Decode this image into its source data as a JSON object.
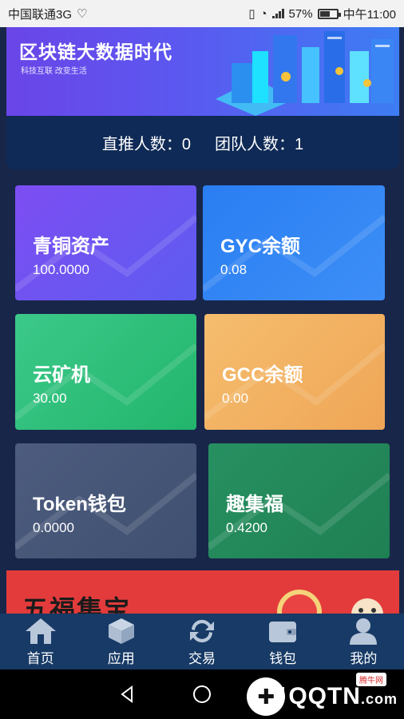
{
  "status_bar": {
    "carrier": "中国联通3G",
    "network": "3G",
    "battery": "57%",
    "time": "中午11:00"
  },
  "banner": {
    "title": "区块链大数据时代",
    "subtitle": "科技互联 改变生活"
  },
  "stats": {
    "direct_label": "直推人数：",
    "direct_value": "0",
    "team_label": "团队人数：",
    "team_value": "1"
  },
  "cards": [
    {
      "title": "青铜资产",
      "value": "100.0000",
      "color": "#6b4ff0"
    },
    {
      "title": "GYC余额",
      "value": "0.08",
      "color": "#2f7ef0"
    },
    {
      "title": "云矿机",
      "value": "30.00",
      "color": "#2fc07a"
    },
    {
      "title": "GCC余额",
      "value": "0.00",
      "color": "#f1b15f"
    },
    {
      "title": "Token钱包",
      "value": "0.0000",
      "color": "#465675"
    },
    {
      "title": "趣集福",
      "value": "0.4200",
      "color": "#23885a"
    }
  ],
  "promo": {
    "text": "五福集宝"
  },
  "tabbar": {
    "items": [
      {
        "label": "首页",
        "icon": "home-icon"
      },
      {
        "label": "应用",
        "icon": "box-icon"
      },
      {
        "label": "交易",
        "icon": "refresh-icon"
      },
      {
        "label": "钱包",
        "icon": "wallet-icon"
      },
      {
        "label": "我的",
        "icon": "user-icon"
      }
    ]
  },
  "watermark": {
    "brand": "QQTN",
    "domain": ".com",
    "badge": "腾牛网"
  },
  "colors": {
    "page_bg": "#18264a",
    "tabbar_bg": "#173a66",
    "promo_bg": "#e33b3b"
  }
}
